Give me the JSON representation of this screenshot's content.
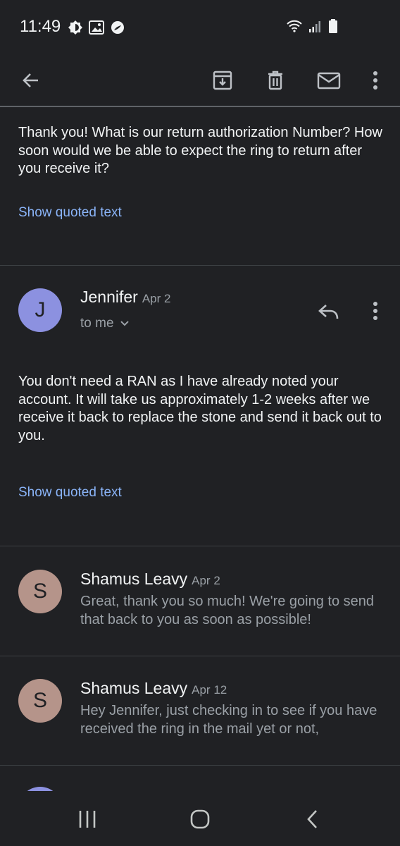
{
  "status_bar": {
    "time": "11:49",
    "left_icons": [
      "brightness-icon",
      "image-icon",
      "app-notification-icon"
    ],
    "right_icons": [
      "wifi-icon",
      "signal-icon",
      "battery-icon"
    ]
  },
  "app_bar": {
    "actions": [
      "back-arrow-icon",
      "archive-icon",
      "delete-icon",
      "mark-unread-icon",
      "more-vert-icon"
    ]
  },
  "thread": {
    "message1": {
      "body": "Thank you! What is our return authorization Number? How soon would we be able to expect the ring to return after you receive it?",
      "show_quoted": "Show quoted text"
    },
    "message2": {
      "avatar_letter": "J",
      "avatar_color": "#8c91e0",
      "sender": "Jennifer",
      "date": "Apr 2",
      "recipient": "to me",
      "body": "You don't need a RAN as I have already noted your account. It will take us approximately 1-2 weeks after we receive it back to replace the stone and send it back out to you.",
      "show_quoted": "Show quoted text"
    },
    "collapsed": [
      {
        "avatar_letter": "S",
        "avatar_color": "#b5948a",
        "sender": "Shamus Leavy",
        "date": "Apr 2",
        "snippet": "Great, thank you so much! We're going to send that back to you as soon as possible!"
      },
      {
        "avatar_letter": "S",
        "avatar_color": "#b5948a",
        "sender": "Shamus Leavy",
        "date": "Apr 12",
        "snippet": "Hey Jennifer, just checking in to see if you have received the ring in the mail yet or not,"
      }
    ]
  },
  "nav_bar": {
    "buttons": [
      "recents-icon",
      "home-icon",
      "back-icon"
    ]
  },
  "colors": {
    "background": "#202124",
    "link": "#8ab4f8",
    "secondary_text": "#9aa0a6"
  }
}
